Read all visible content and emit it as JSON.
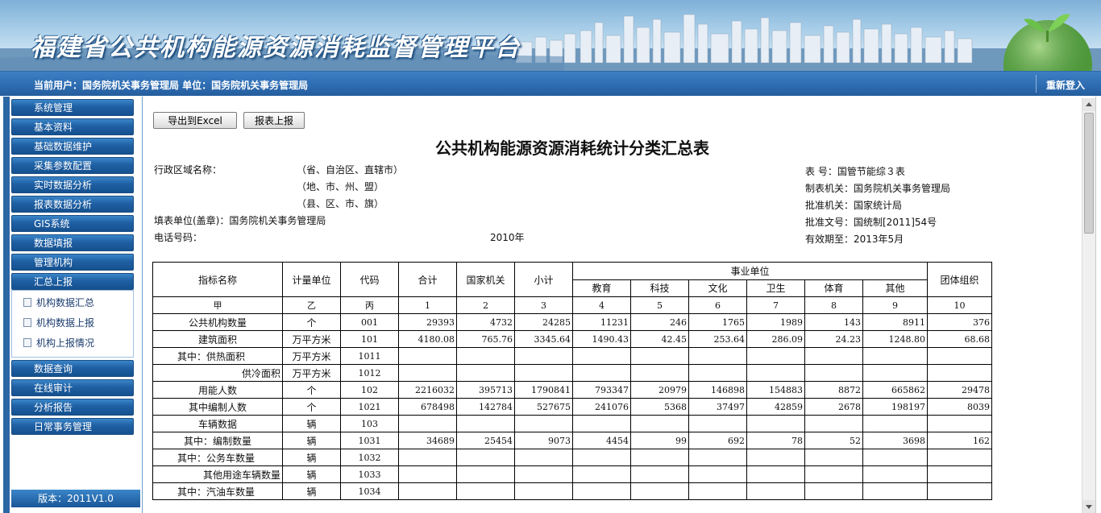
{
  "app": {
    "title": "福建省公共机构能源资源消耗监督管理平台",
    "user_info": "当前用户：国务院机关事务管理局   单位：国务院机关事务管理局",
    "relogin": "重新登入",
    "version": "版本：2011V1.0"
  },
  "menu": {
    "items_top": [
      "系统管理",
      "基本资料",
      "基础数据维护",
      "采集参数配置",
      "实时数据分析",
      "报表数据分析",
      "GIS系统",
      "数据填报",
      "管理机构",
      "汇总上报"
    ],
    "sub_items": [
      "机构数据汇总",
      "机构数据上报",
      "机构上报情况"
    ],
    "items_bottom": [
      "数据查询",
      "在线审计",
      "分析报告",
      "日常事务管理"
    ]
  },
  "toolbar": {
    "export": "导出到Excel",
    "submit": "报表上报"
  },
  "report": {
    "title": "公共机构能源资源消耗统计分类汇总表",
    "left": {
      "region_label": "行政区域名称：",
      "region_1": "（省、自治区、直辖市）",
      "region_2": "（地、市、州、盟）",
      "region_3": "（县、区、市、旗）",
      "filler": "填表单位(盖章)：国务院机关事务管理局",
      "phone": "电话号码：",
      "year": "2010年"
    },
    "right": {
      "form_no": "表      号：国管节能综３表",
      "maker": "制表机关：国务院机关事务管理局",
      "approver": "批准机关：国家统计局",
      "approval_no": "批准文号：国统制[2011]54号",
      "valid": "有效期至：2013年5月"
    }
  },
  "table": {
    "h_name": "指标名称",
    "h_unit": "计量单位",
    "h_code": "代码",
    "h_total": "合计",
    "h_gov": "国家机关",
    "h_sub": "小计",
    "h_inst": "事业单位",
    "h_org": "团体组织",
    "inst_cols": [
      "教育",
      "科技",
      "文化",
      "卫生",
      "体育",
      "其他"
    ],
    "index_row": [
      "甲",
      "乙",
      "丙",
      "1",
      "2",
      "3",
      "4",
      "5",
      "6",
      "7",
      "8",
      "9",
      "10"
    ],
    "rows": [
      {
        "name": "公共机构数量",
        "align": "c",
        "unit": "个",
        "code": "001",
        "v": [
          "29393",
          "4732",
          "24285",
          "11231",
          "246",
          "1765",
          "1989",
          "143",
          "8911",
          "376"
        ]
      },
      {
        "name": "建筑面积",
        "align": "c",
        "unit": "万平方米",
        "code": "101",
        "v": [
          "4180.08",
          "765.76",
          "3345.64",
          "1490.43",
          "42.45",
          "253.64",
          "286.09",
          "24.23",
          "1248.80",
          "68.68"
        ]
      },
      {
        "name": "其中：供热面积",
        "align": "l",
        "unit": "万平方米",
        "code": "1011",
        "v": [
          "",
          "",
          "",
          "",
          "",
          "",
          "",
          "",
          "",
          ""
        ]
      },
      {
        "name": "供冷面积",
        "align": "r",
        "unit": "万平方米",
        "code": "1012",
        "v": [
          "",
          "",
          "",
          "",
          "",
          "",
          "",
          "",
          "",
          ""
        ]
      },
      {
        "name": "用能人数",
        "align": "c",
        "unit": "个",
        "code": "102",
        "v": [
          "2216032",
          "395713",
          "1790841",
          "793347",
          "20979",
          "146898",
          "154883",
          "8872",
          "665862",
          "29478"
        ]
      },
      {
        "name": "其中编制人数",
        "align": "c",
        "unit": "个",
        "code": "1021",
        "v": [
          "678498",
          "142784",
          "527675",
          "241076",
          "5368",
          "37497",
          "42859",
          "2678",
          "198197",
          "8039"
        ]
      },
      {
        "name": "车辆数据",
        "align": "c",
        "unit": "辆",
        "code": "103",
        "v": [
          "",
          "",
          "",
          "",
          "",
          "",
          "",
          "",
          "",
          ""
        ]
      },
      {
        "name": "其中：编制数量",
        "align": "c",
        "unit": "辆",
        "code": "1031",
        "v": [
          "34689",
          "25454",
          "9073",
          "4454",
          "99",
          "692",
          "78",
          "52",
          "3698",
          "162"
        ]
      },
      {
        "name": "其中：公务车数量",
        "align": "l",
        "unit": "辆",
        "code": "1032",
        "v": [
          "",
          "",
          "",
          "",
          "",
          "",
          "",
          "",
          "",
          ""
        ]
      },
      {
        "name": "其他用途车辆数量",
        "align": "r",
        "unit": "辆",
        "code": "1033",
        "v": [
          "",
          "",
          "",
          "",
          "",
          "",
          "",
          "",
          "",
          ""
        ]
      },
      {
        "name": "其中：汽油车数量",
        "align": "l",
        "unit": "辆",
        "code": "1034",
        "v": [
          "",
          "",
          "",
          "",
          "",
          "",
          "",
          "",
          "",
          ""
        ]
      }
    ]
  }
}
